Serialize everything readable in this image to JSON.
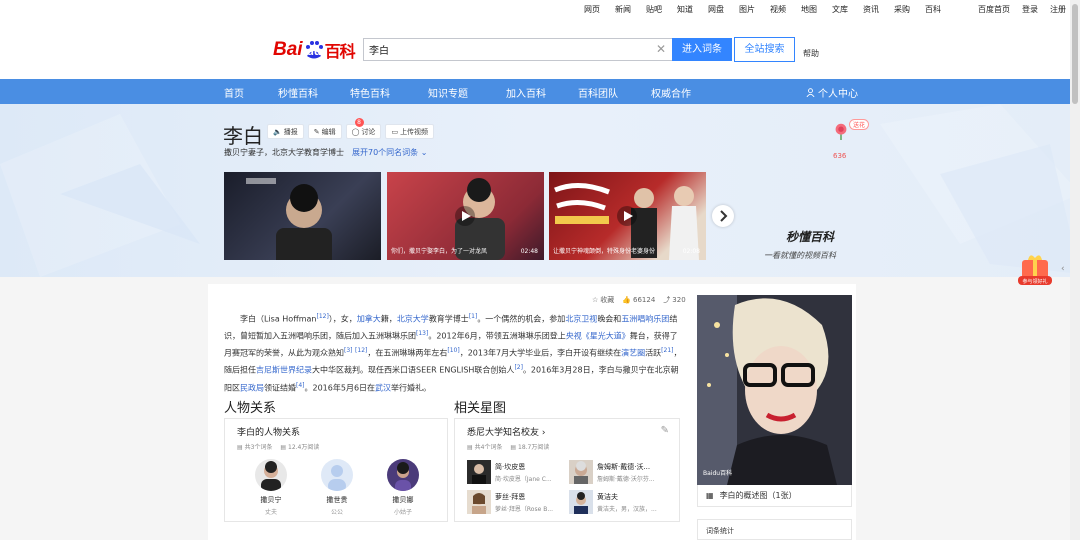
{
  "topnav": {
    "links": [
      "网页",
      "新闻",
      "贴吧",
      "知道",
      "网盘",
      "图片",
      "视频",
      "地图",
      "文库",
      "资讯",
      "采购",
      "百科"
    ],
    "right": [
      "百度首页",
      "登录",
      "注册"
    ]
  },
  "header": {
    "logo_bai": "Bai",
    "logo_du": "du",
    "logo_baike": "百科",
    "search_value": "李白",
    "enter_label": "进入词条",
    "all_label": "全站搜索",
    "help_label": "帮助"
  },
  "navbar": {
    "items": [
      "首页",
      "秒懂百科",
      "特色百科",
      "知识专题",
      "加入百科",
      "百科团队",
      "权威合作"
    ],
    "user_center": "个人中心"
  },
  "entry": {
    "title": "李白",
    "actions": [
      "播报",
      "编辑",
      "讨论",
      "上传视频"
    ],
    "discuss_badge": "8",
    "subtitle": "撒贝宁妻子，北京大学教育学博士",
    "more_names": "展开70个同名词条",
    "flower_label": "送花",
    "flower_count": "636"
  },
  "videos": [
    {
      "caption": "",
      "duration": ""
    },
    {
      "caption": "你们，撒贝宁娶李白，为了一对龙凤",
      "duration": "02:48"
    },
    {
      "caption": "让撒贝宁神魂颠倒，特殊身份老婆身份",
      "duration": "02:08"
    }
  ],
  "brand": {
    "name": "秒懂百科",
    "slogan": "一看就懂的视频百科"
  },
  "meta": {
    "collect": "收藏",
    "likes": "66124",
    "shares": "320"
  },
  "summary": {
    "p1": "李白（Lisa Hoffman",
    "r1": "[12]",
    "p2": "），女，",
    "l1": "加拿大",
    "p3": "籍，",
    "l2": "北京大学",
    "p4": "教育学博士",
    "r2": "[1]",
    "p5": "。一个偶然的机会，参加",
    "l3": "北京卫视",
    "p6": "晚会和",
    "l4": "五洲唱响乐团",
    "p7": "结识，曾短暂加入五洲唱响乐团，随后加入五洲琳琳乐团",
    "r3": "[13]",
    "p8": "。2012年6月，带领五洲琳琳乐团登上",
    "l5": "央视",
    "l6": "《星光大道》",
    "p9": "舞台，获得了月赛冠军的荣誉，从此为观众熟知",
    "r4": "[3]",
    "r5": "[12]",
    "p10": "，在五洲琳琳两年左右",
    "r6": "[10]",
    "p11": "，2013年7月大学毕业后，李白开设有继续在",
    "l7": "演艺圈",
    "p12": "活跃",
    "r7": "[21]",
    "p13": "，随后担任",
    "l8": "吉尼斯世界纪录",
    "p14": "大中华区裁判。现任西米口语SEER ENGLISH联合创始人",
    "r8": "[2]",
    "p15": "。2016年3月28日，李白与撒贝宁在北京朝阳区",
    "l9": "民政局",
    "p16": "领证结婚",
    "r9": "[4]",
    "p17": "。2016年5月6日在",
    "l10": "武汉",
    "p18": "举行婚礼。"
  },
  "relations": {
    "section_title": "人物关系",
    "card_title": "李白的人物关系",
    "entries_count": "共3个词条",
    "views": "12.4万阅读",
    "people": [
      {
        "name": "撒贝宁",
        "role": "丈夫"
      },
      {
        "name": "撒世贵",
        "role": "公公"
      },
      {
        "name": "撒贝娜",
        "role": "小姑子"
      }
    ]
  },
  "stars": {
    "section_title": "相关星图",
    "card_title": "悉尼大学知名校友",
    "entries_count": "共4个词条",
    "views": "18.7万阅读",
    "people": [
      {
        "name": "简·坎皮恩",
        "sub": "简·坎皮恩（Jane C..."
      },
      {
        "name": "詹姆斯·戴德·沃...",
        "sub": "詹姆斯·戴德·沃尔芬..."
      },
      {
        "name": "萝丝·拜恩",
        "sub": "萝丝·拜恩（Rose B..."
      },
      {
        "name": "黄洁夫",
        "sub": "黄洁夫，男，汉族，..."
      }
    ]
  },
  "sidebar": {
    "photo_caption": "李白的概述图（1张）",
    "photo_watermark": "Baidu百科",
    "stats_title": "词条统计"
  },
  "gift": {
    "label": "参与领好礼"
  }
}
